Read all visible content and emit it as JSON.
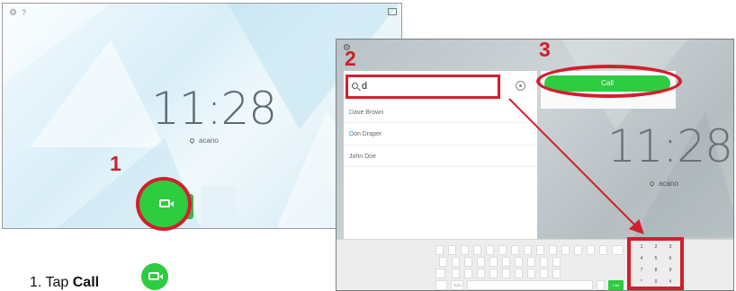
{
  "panel1": {
    "time": "11:28",
    "location": "acano",
    "step_label": "1"
  },
  "panel2": {
    "step_search_label": "2",
    "step_call_label": "3",
    "search": {
      "value": "d"
    },
    "contacts": [
      {
        "highlight": "D",
        "rest": "ave Brown"
      },
      {
        "highlight": "D",
        "rest": "on Draper"
      },
      {
        "highlight": "",
        "rest": "John Doe"
      }
    ],
    "call_button_label": "Call",
    "time": "11:28",
    "location": "acano"
  },
  "keyboard": {
    "numpad_keys": [
      "1",
      "2",
      "3",
      "4",
      "5",
      "6",
      "7",
      "8",
      "9",
      "*",
      "0",
      "#"
    ],
    "call_key_label": "Call",
    "num_label": "?123"
  },
  "caption": {
    "prefix": "1. Tap ",
    "bold": "Call"
  },
  "colors": {
    "accent_red": "#d31f2c",
    "call_green": "#2ecc40",
    "step_red": "#cc1f2a"
  },
  "icons": [
    "gear-icon",
    "help-icon",
    "cast-icon",
    "location-pin-icon",
    "video-camera-icon",
    "search-icon",
    "clear-icon"
  ]
}
